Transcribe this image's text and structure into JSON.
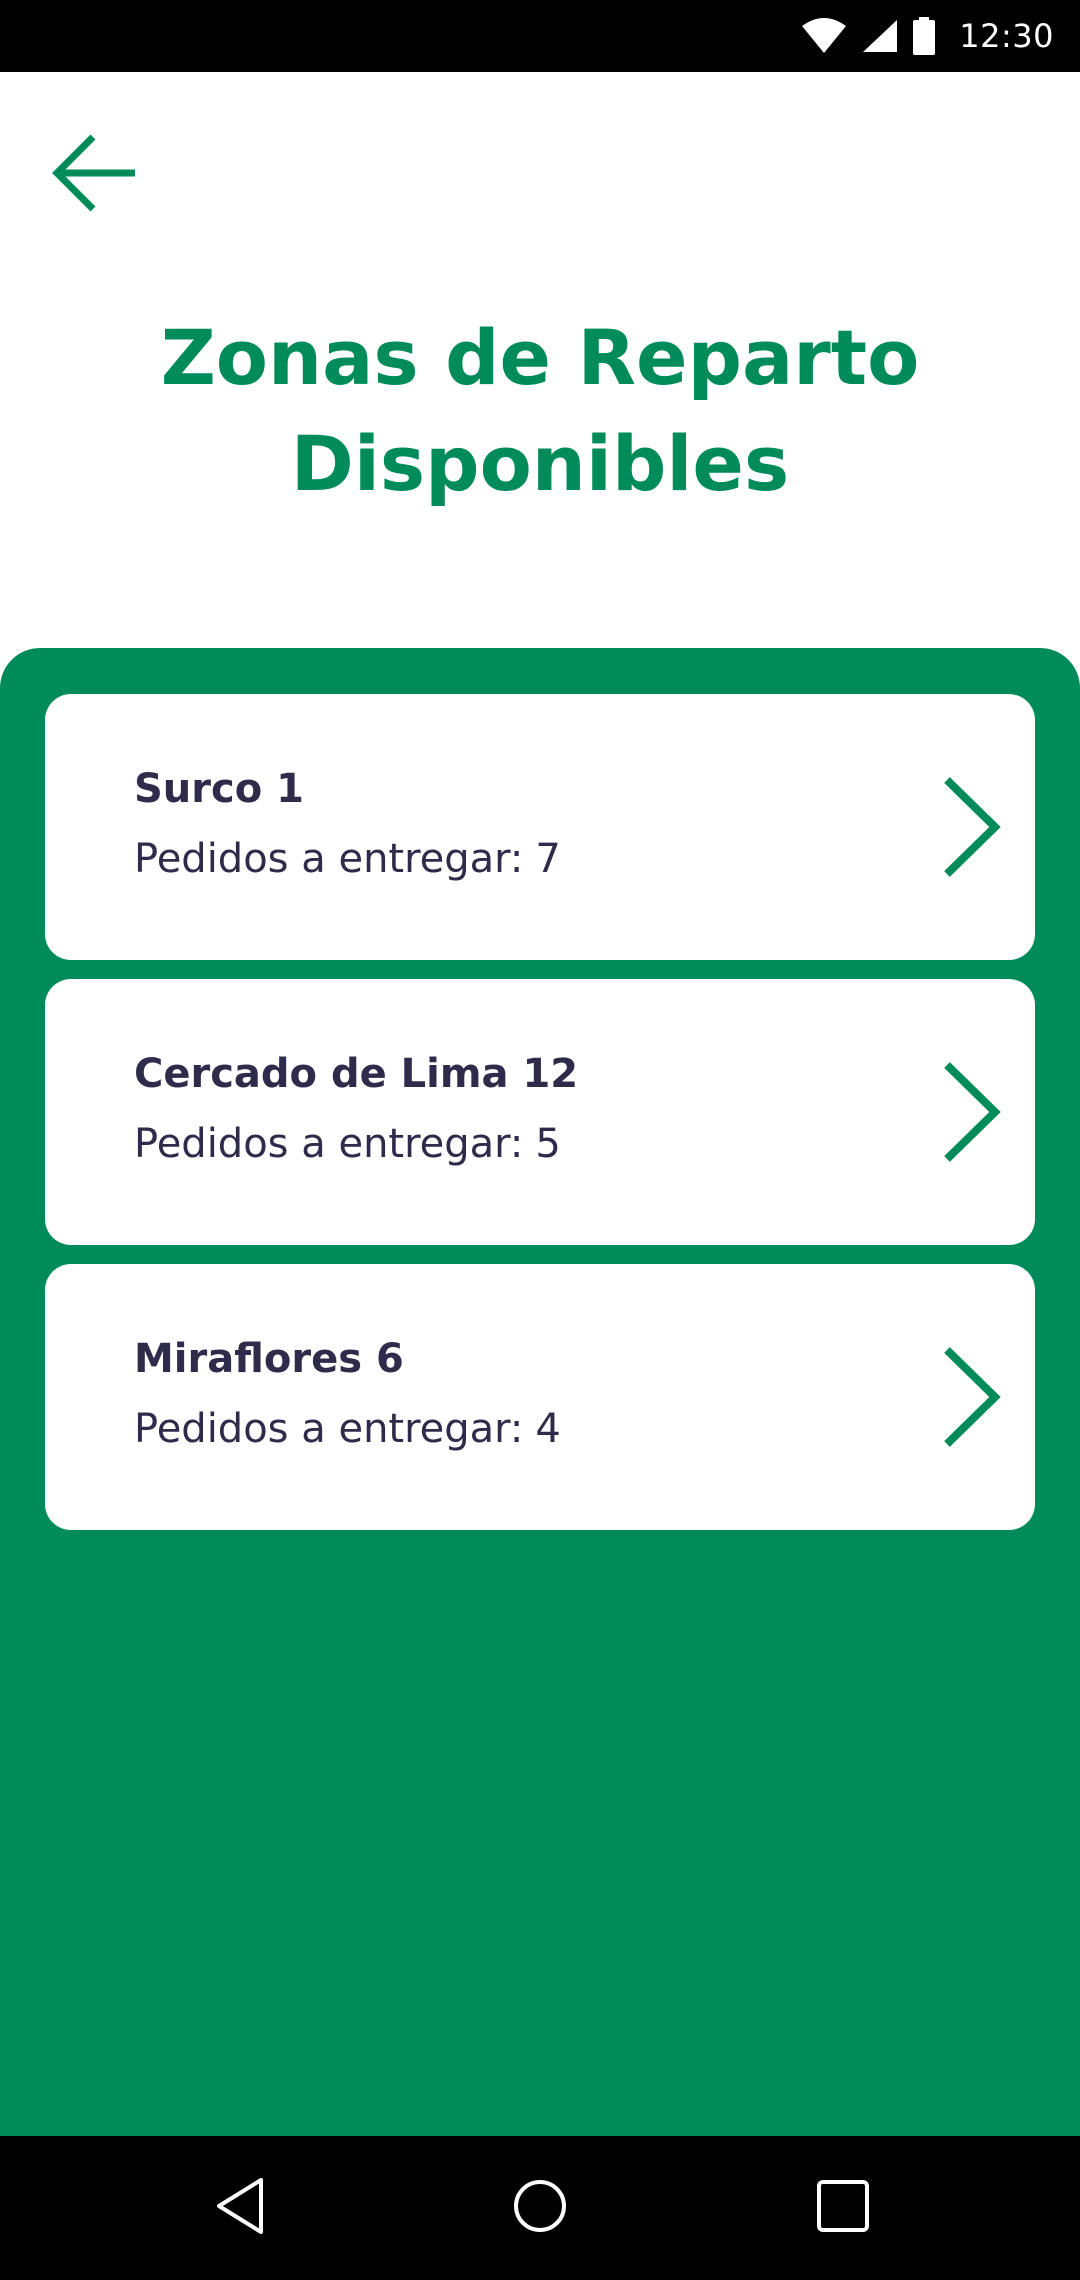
{
  "status_bar": {
    "time": "12:30",
    "icons": [
      "wifi-icon",
      "signal-icon",
      "battery-icon"
    ]
  },
  "header": {
    "back_icon": "arrow-left-icon",
    "title_line1": "Zonas de Reparto",
    "title_line2": "Disponibles"
  },
  "zones": [
    {
      "name": "Surco 1",
      "orders_label": "Pedidos a entregar:",
      "orders_count": "7"
    },
    {
      "name": "Cercado de Lima 12",
      "orders_label": "Pedidos a entregar:",
      "orders_count": "5"
    },
    {
      "name": "Miraflores 6",
      "orders_label": "Pedidos a entregar:",
      "orders_count": "4"
    }
  ],
  "nav_bar": {
    "icons": [
      "back-triangle-icon",
      "home-circle-icon",
      "recents-square-icon"
    ]
  },
  "colors": {
    "accent": "#008c5a",
    "card_text": "#2e2c4a",
    "card_background": "#ffffff",
    "system_bars": "#000000"
  }
}
